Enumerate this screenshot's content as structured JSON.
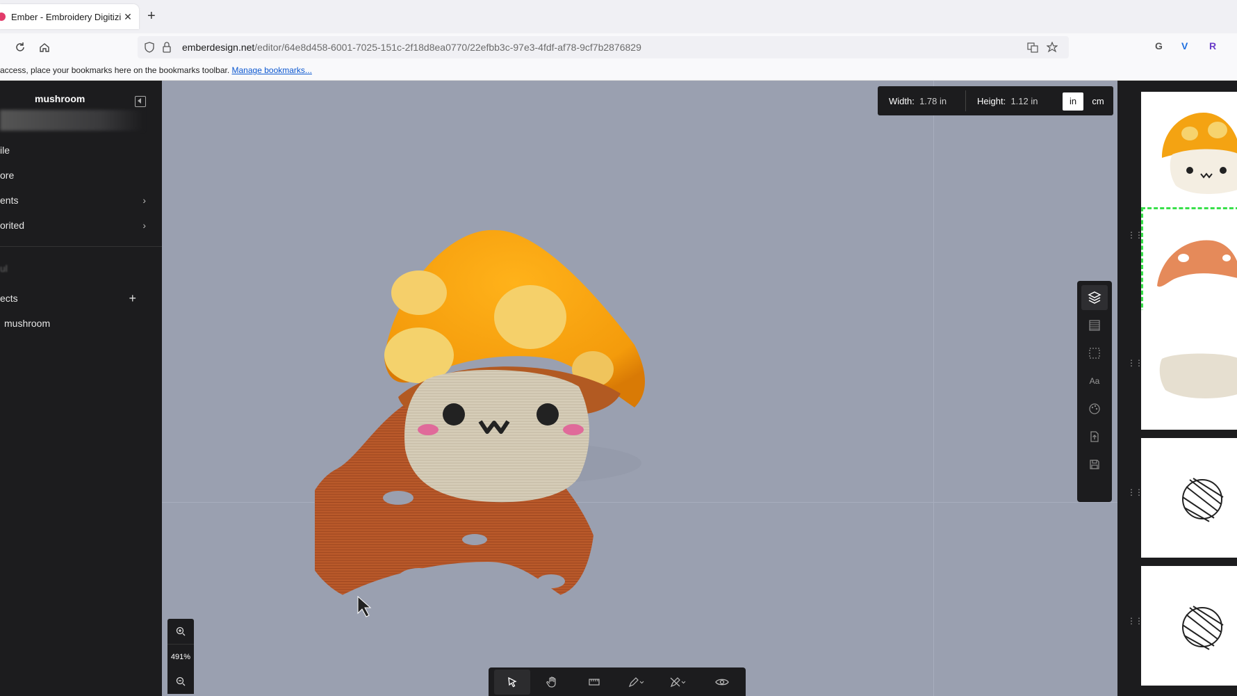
{
  "browser": {
    "tab_title": "Ember - Embroidery Digitizing",
    "url_host": "emberdesign.net",
    "url_path": "/editor/64e8d458-6001-7025-151c-2f18d8ea0770/22efbb3c-97e3-4fdf-af78-9cf7b2876829",
    "bookmarks_text": "access, place your bookmarks here on the bookmarks toolbar.",
    "bookmarks_link": "Manage bookmarks...",
    "ext_icons": [
      "G",
      "V",
      "R"
    ]
  },
  "sidebar": {
    "project_title": "mushroom",
    "items": [
      {
        "label": "ile"
      },
      {
        "label": "ore"
      },
      {
        "label": "ents"
      },
      {
        "label": "orited"
      },
      {
        "label": "ul"
      },
      {
        "label": "ects"
      },
      {
        "label": "mushroom"
      }
    ]
  },
  "canvas": {
    "width_label": "Width:",
    "width_value": "1.78 in",
    "height_label": "Height:",
    "height_value": "1.12 in",
    "unit_in": "in",
    "unit_cm": "cm",
    "zoom": "491%"
  },
  "icons": {
    "zoom_in": "zoom-in-icon",
    "zoom_out": "zoom-out-icon",
    "layers": "layers-icon",
    "select": "cursor-icon",
    "hand": "hand-icon"
  },
  "colors": {
    "accent_selected": "#38e04a",
    "canvas_bg": "#9aa0b0",
    "panel_bg": "#1c1c1e"
  }
}
